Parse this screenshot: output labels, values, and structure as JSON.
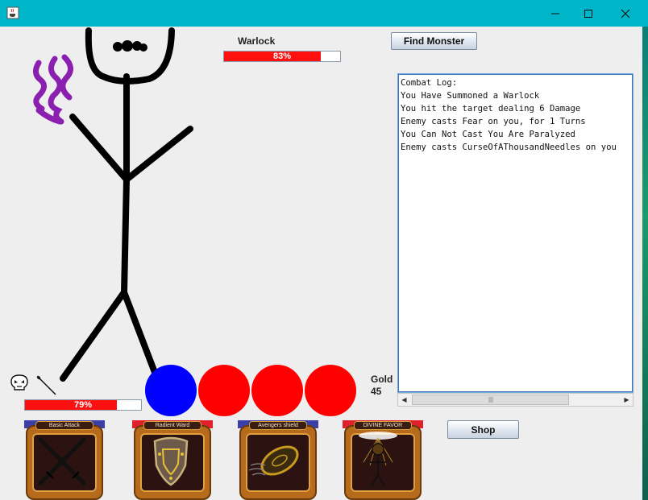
{
  "window": {
    "icon": "java-cup-icon",
    "controls": [
      "minimize-icon",
      "maximize-icon",
      "close-icon"
    ]
  },
  "enemy": {
    "name": "Warlock",
    "hp_percent": 83,
    "hp_label": "83%"
  },
  "buttons": {
    "find_monster": "Find Monster",
    "shop": "Shop"
  },
  "combat_log": {
    "lines": [
      "Combat Log:",
      "You Have Summoned a Warlock",
      "You hit the target dealing 6 Damage",
      "Enemy casts Fear on you, for 1 Turns",
      "You Can Not Cast You Are Paralyzed",
      "Enemy casts CurseOfAThousandNeedles on you"
    ]
  },
  "player": {
    "hp_percent": 79,
    "hp_label": "79%",
    "status_icons": [
      "skull-fear-icon",
      "needle-curse-icon"
    ]
  },
  "mana_orbs": [
    {
      "state": "used",
      "color": "#0000ff"
    },
    {
      "state": "available",
      "color": "#ff0000"
    },
    {
      "state": "available",
      "color": "#ff0000"
    },
    {
      "state": "available",
      "color": "#ff0000"
    }
  ],
  "gold": {
    "label": "Gold",
    "value": "45"
  },
  "abilities": [
    {
      "label": "Basic Attack",
      "tab_color": "#3b3fa8",
      "icon": "crossed-swords-icon"
    },
    {
      "label": "Radient Ward",
      "tab_color": "#e0202a",
      "icon": "shield-icon"
    },
    {
      "label": "Avengers shield",
      "tab_color": "#3b3fa8",
      "icon": "spinning-shield-icon"
    },
    {
      "label": "DIVINE FAVOR",
      "tab_color": "#e0202a",
      "icon": "haloed-figure-icon"
    }
  ],
  "colors": {
    "titlebar": "#00b5c7",
    "client_bg": "#eeeeee",
    "hp_fill": "#ff1010",
    "stick_figure": "#000000",
    "aura": "#8a1fb0"
  }
}
